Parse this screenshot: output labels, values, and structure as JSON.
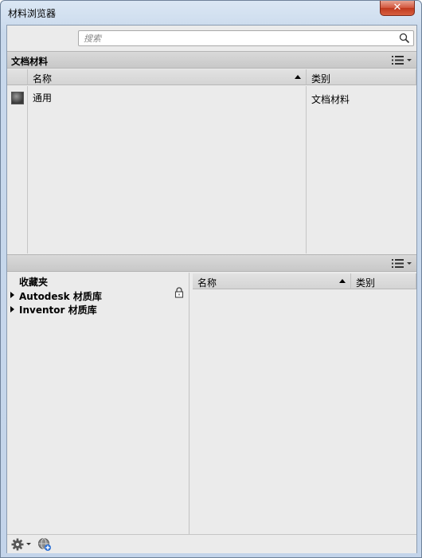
{
  "window": {
    "title": "材料浏览器",
    "close_label": "✕"
  },
  "search": {
    "placeholder": "搜索"
  },
  "document_materials": {
    "header": "文档材料",
    "columns": {
      "name": "名称",
      "category": "类别"
    },
    "rows": [
      {
        "name": "通用",
        "category": "文档材料"
      }
    ]
  },
  "libraries": {
    "favorites_label": "收藏夹",
    "items": [
      {
        "name": "Autodesk 材质库",
        "locked": true
      },
      {
        "name": "Inventor 材质库",
        "locked": false
      }
    ],
    "columns": {
      "name": "名称",
      "category": "类别"
    }
  }
}
